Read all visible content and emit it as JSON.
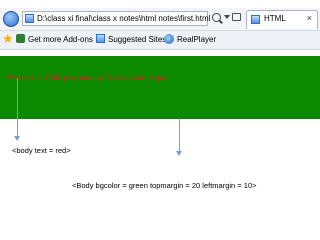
{
  "address_bar": {
    "url": "D:\\class xi final\\class x notes\\html notes\\first.html",
    "tab_title": "HTML",
    "tab_close": "×"
  },
  "favorites_bar": {
    "add_ons": "Get more Add-ons",
    "suggested_sites": "Suggested Sites",
    "realplayer": "RealPlayer"
  },
  "page": {
    "welcome_text": "Welcome to HTML programming. This is a basic program.",
    "background_color": "#0b8a00",
    "text_color": "#e81a1a"
  },
  "annotations": {
    "body_text": "<body text = red>",
    "body_bgcolor": "<Body bgcolor = green topmargin = 20 leftmargin = 10>"
  }
}
